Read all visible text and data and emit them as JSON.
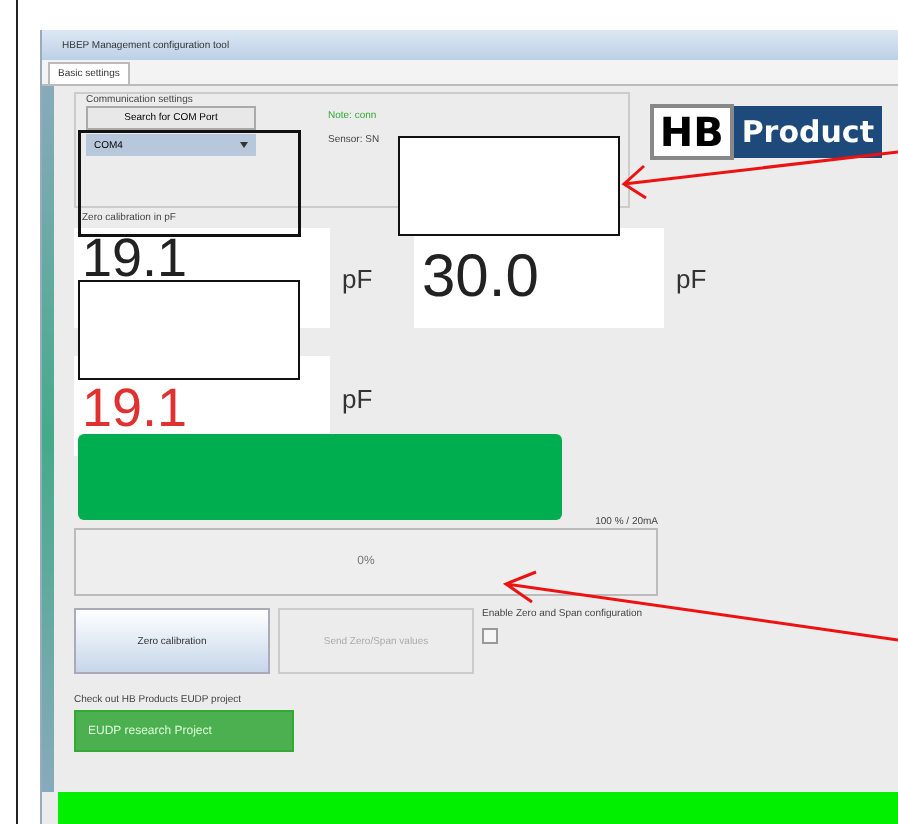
{
  "window": {
    "title": "HBEP Management configuration tool"
  },
  "tabs": [
    {
      "label": "Basic settings",
      "selected": true
    }
  ],
  "communication": {
    "title": "Communication settings",
    "search_button": "Search for COM Port",
    "port": "COM4",
    "note": "Note: conn",
    "sensor": "Sensor: SN"
  },
  "logo": {
    "text_1": "HB",
    "text_2": "Product"
  },
  "zero": {
    "label": "Zero calibration in pF",
    "value": "19.1",
    "unit": "pF"
  },
  "span": {
    "value": "30.0",
    "unit": "pF"
  },
  "current": {
    "value": "19.1",
    "unit": "pF"
  },
  "progress": {
    "right_label": "100 % / 20mA",
    "text": "0%",
    "level": 0
  },
  "buttons": [
    {
      "label": "Zero calibration",
      "disabled": false
    },
    {
      "label": "Send Zero/Span values",
      "disabled": true
    }
  ],
  "enable": {
    "label": "Enable Zero and Span configuration",
    "checked": false
  },
  "eudp": {
    "label": "Check out HB Products EUDP project",
    "button": "EUDP research Project"
  }
}
